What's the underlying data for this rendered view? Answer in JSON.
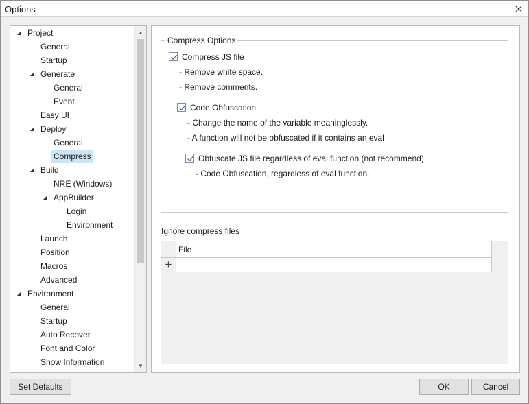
{
  "window": {
    "title": "Options"
  },
  "tree": [
    {
      "label": "Project",
      "expanded": true
    },
    {
      "label": "General"
    },
    {
      "label": "Startup"
    },
    {
      "label": "Generate",
      "expanded": true
    },
    {
      "label": "General"
    },
    {
      "label": "Event"
    },
    {
      "label": "Easy UI"
    },
    {
      "label": "Deploy",
      "expanded": true
    },
    {
      "label": "General"
    },
    {
      "label": "Compress",
      "selected": true
    },
    {
      "label": "Build",
      "expanded": true
    },
    {
      "label": "NRE (Windows)"
    },
    {
      "label": "AppBuilder",
      "expanded": true
    },
    {
      "label": "Login"
    },
    {
      "label": "Environment"
    },
    {
      "label": "Launch"
    },
    {
      "label": "Position"
    },
    {
      "label": "Macros"
    },
    {
      "label": "Advanced"
    },
    {
      "label": "Environment",
      "expanded": true
    },
    {
      "label": "General"
    },
    {
      "label": "Startup"
    },
    {
      "label": "Auto Recover"
    },
    {
      "label": "Font and Color"
    },
    {
      "label": "Show Information"
    }
  ],
  "compress": {
    "group_title": "Compress Options",
    "compress_js": {
      "label": "Compress JS file",
      "checked": true
    },
    "notes1": [
      "- Remove white space.",
      "- Remove comments."
    ],
    "obfuscation": {
      "label": "Code Obfuscation",
      "checked": true
    },
    "notes2": [
      "- Change the name of the variable meaninglessly.",
      "- A function will not be obfuscated if it contains an eval"
    ],
    "obfuscate_eval": {
      "label": "Obfuscate JS file regardless of eval function (not recommend)",
      "checked": true
    },
    "notes3": [
      "- Code Obfuscation, regardless of eval function."
    ]
  },
  "ignore": {
    "label": "Ignore compress files",
    "column_header": "File",
    "add_symbol": "+"
  },
  "buttons": {
    "set_defaults": "Set Defaults",
    "ok": "OK",
    "cancel": "Cancel"
  },
  "colors": {
    "selection": "#cce4f7",
    "check": "#3a6fb0"
  }
}
